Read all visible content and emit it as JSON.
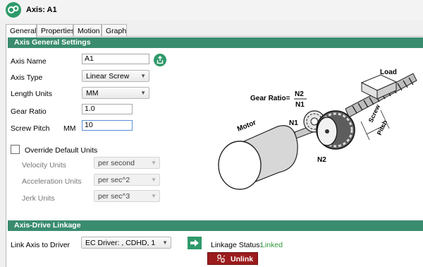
{
  "window": {
    "title": "Axis: A1",
    "app_icon": "gear-app-icon"
  },
  "tabs": [
    {
      "label": "General",
      "active": true
    },
    {
      "label": "Properties",
      "active": false
    },
    {
      "label": "Motion",
      "active": false
    },
    {
      "label": "Graph",
      "active": false
    }
  ],
  "general_settings": {
    "header": "Axis General Settings",
    "axis_name": {
      "label": "Axis Name",
      "value": "A1"
    },
    "axis_type": {
      "label": "Axis Type",
      "value": "Linear Screw"
    },
    "length_units": {
      "label": "Length Units",
      "value": "MM"
    },
    "gear_ratio": {
      "label": "Gear Ratio",
      "value": "1.0"
    },
    "screw_pitch": {
      "label": "Screw Pitch",
      "unit": "MM",
      "value": "10"
    },
    "override": {
      "label": "Override Default Units",
      "checked": false,
      "velocity": {
        "label": "Velocity Units",
        "value": "per second"
      },
      "acceleration": {
        "label": "Acceleration Units",
        "value": "per sec^2"
      },
      "jerk": {
        "label": "Jerk Units",
        "value": "per sec^3"
      }
    }
  },
  "diagram": {
    "gear_ratio_label": "Gear Ratio=",
    "numerator": "N2",
    "denominator": "N1",
    "load": "Load",
    "n1": "N1",
    "n2": "N2",
    "motor": "Motor",
    "screw": "Screw",
    "pitch": "Pitch"
  },
  "linkage": {
    "header": "Axis-Drive Linkage",
    "link_label": "Link Axis to Driver",
    "driver_value": "EC Driver: , CDHD, 1",
    "status_label": "Linkage Status:",
    "status_value": "Linked",
    "status_color": "#2e9a3a",
    "unlink_label": "Unlink"
  },
  "colors": {
    "accent": "#3a8c6f",
    "unlink": "#9b1c1c"
  }
}
